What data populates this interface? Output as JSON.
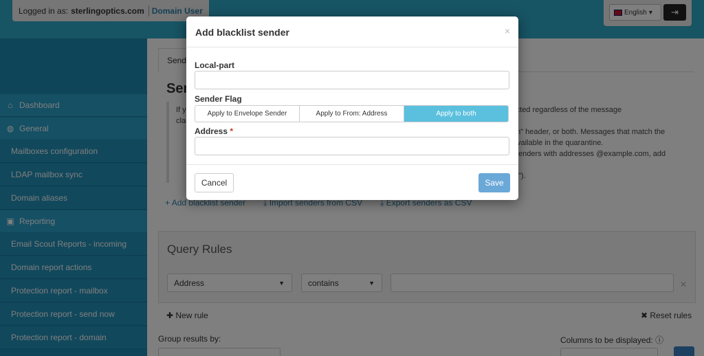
{
  "header": {
    "logged_in_label": "Logged in as:",
    "domain": "sterlingoptics.com",
    "role": "Domain User",
    "language": "English",
    "logout_icon": "logout-icon"
  },
  "sidebar": {
    "items": [
      {
        "label": "Dashboard",
        "icon": "home-icon",
        "type": "head"
      },
      {
        "label": "General",
        "icon": "globe-icon",
        "type": "head"
      },
      {
        "label": "Mailboxes configuration",
        "type": "sub"
      },
      {
        "label": "LDAP mailbox sync",
        "type": "sub"
      },
      {
        "label": "Domain aliases",
        "type": "sub"
      },
      {
        "label": "Reporting",
        "icon": "inbox-icon",
        "type": "head"
      },
      {
        "label": "Email Scout Reports - incoming",
        "type": "sub"
      },
      {
        "label": "Domain report actions",
        "type": "sub"
      },
      {
        "label": "Protection report - mailbox",
        "type": "sub"
      },
      {
        "label": "Protection report - send now",
        "type": "sub"
      },
      {
        "label": "Protection report - domain",
        "type": "sub"
      }
    ]
  },
  "main": {
    "tab_label": "Sende",
    "heading": "Sen",
    "desc": {
      "line1_left": "If y",
      "line1_right": "be rejected regardless of the message",
      "line2_left": "clas",
      "line3_right": "m\" header, or both. Messages that match the",
      "line4_right": "vailable in the quarantine.",
      "line5_right": "enders with addresses @example.com, add",
      "line7_right": "\")."
    },
    "actions": {
      "add": "Add blacklist sender",
      "import": "Import senders from CSV",
      "export": "Export senders as CSV"
    },
    "query_rules": {
      "title": "Query Rules",
      "field": "Address",
      "operator": "contains",
      "value": ""
    },
    "new_rule": "New rule",
    "reset_rules": "Reset rules",
    "group_by_label": "Group results by:",
    "columns_label": "Columns to be displayed:"
  },
  "modal": {
    "title": "Add blacklist sender",
    "close": "×",
    "local_part_label": "Local-part",
    "local_part_value": "",
    "sender_flag_label": "Sender Flag",
    "sender_flag_options": [
      "Apply to Envelope Sender",
      "Apply to From: Address",
      "Apply to both"
    ],
    "sender_flag_selected": "Apply to both",
    "address_label": "Address",
    "address_required": "*",
    "address_value": "",
    "cancel_label": "Cancel",
    "save_label": "Save"
  },
  "colors": {
    "accent": "#2fa8c8",
    "active_segment": "#5bc0de",
    "save_button": "#6aa8d8"
  }
}
